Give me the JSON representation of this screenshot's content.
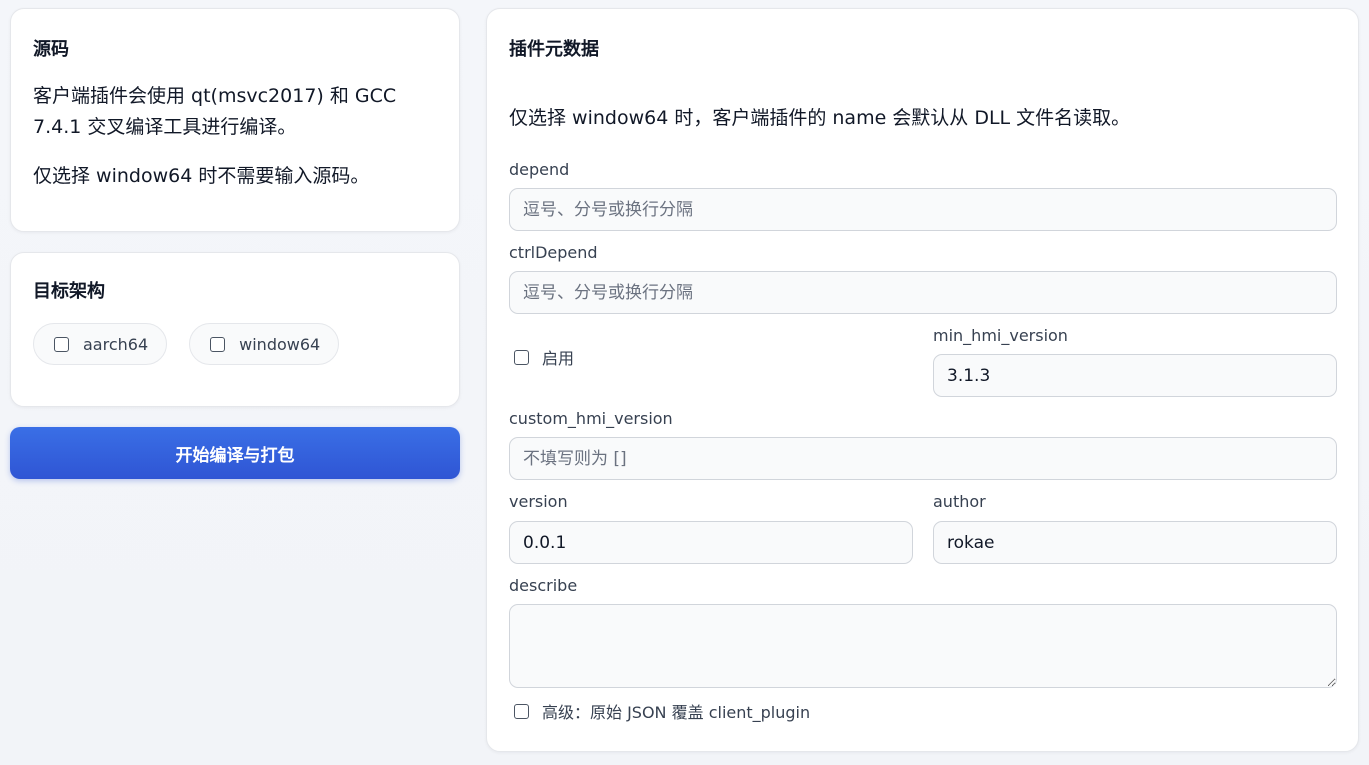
{
  "source": {
    "title": "源码",
    "para1": "客户端插件会使用 qt(msvc2017) 和 GCC 7.4.1 交叉编译工具进行编译。",
    "para2": "仅选择 window64 时不需要输入源码。"
  },
  "arch": {
    "title": "目标架构",
    "options": [
      {
        "label": "aarch64",
        "checked": false
      },
      {
        "label": "window64",
        "checked": false
      }
    ]
  },
  "build_button": {
    "label": "开始编译与打包"
  },
  "meta": {
    "title": "插件元数据",
    "note": "仅选择 window64 时，客户端插件的 name 会默认从 DLL 文件名读取。",
    "depend": {
      "label": "depend",
      "value": "",
      "placeholder": "逗号、分号或换行分隔"
    },
    "ctrlDepend": {
      "label": "ctrlDepend",
      "value": "",
      "placeholder": "逗号、分号或换行分隔"
    },
    "enable": {
      "label": "启用",
      "checked": false
    },
    "min_hmi_version": {
      "label": "min_hmi_version",
      "value": "3.1.3"
    },
    "custom_hmi_version": {
      "label": "custom_hmi_version",
      "value": "",
      "placeholder": "不填写则为 []"
    },
    "version": {
      "label": "version",
      "value": "0.0.1"
    },
    "author": {
      "label": "author",
      "value": "rokae"
    },
    "describe": {
      "label": "describe",
      "value": ""
    },
    "advanced": {
      "label": "高级：原始 JSON 覆盖 client_plugin",
      "checked": false
    }
  },
  "colors": {
    "accent": "#2f55d4",
    "background": "#f3f5f9",
    "card": "#ffffff",
    "border": "#e5e7eb"
  }
}
